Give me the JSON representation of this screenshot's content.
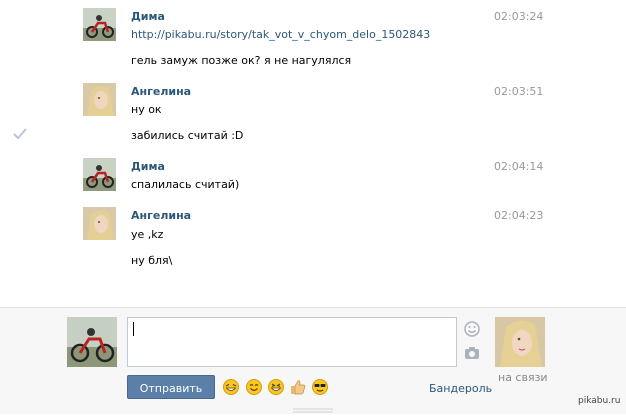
{
  "messages": [
    {
      "author": "Дима",
      "time": "02:03:24",
      "link": "http://pikabu.ru/story/tak_vot_v_chyom_delo_1502843",
      "lines": [
        "гель замуж позже ок? я не нагулялся"
      ]
    },
    {
      "author": "Ангелина",
      "time": "02:03:51",
      "lines": [
        "ну ок",
        "забились считай :D"
      ]
    },
    {
      "author": "Дима",
      "time": "02:04:14",
      "lines": [
        "спалилась считай)"
      ]
    },
    {
      "author": "Ангелина",
      "time": "02:04:23",
      "lines": [
        "ye ,kz",
        "ну бля\\"
      ]
    }
  ],
  "composer": {
    "send_label": "Отправить",
    "parcel_label": "Бандероль",
    "peer_status": "на связи",
    "text_value": ""
  },
  "emojis": [
    "laughing-emoji-icon",
    "smile-emoji-icon",
    "grin-emoji-icon",
    "thumbs-up-icon",
    "sunglasses-emoji-icon"
  ],
  "watermark": "pikabu.ru",
  "colors": {
    "link": "#2b587a",
    "send_button": "#5b7fa6",
    "time": "#999999"
  }
}
